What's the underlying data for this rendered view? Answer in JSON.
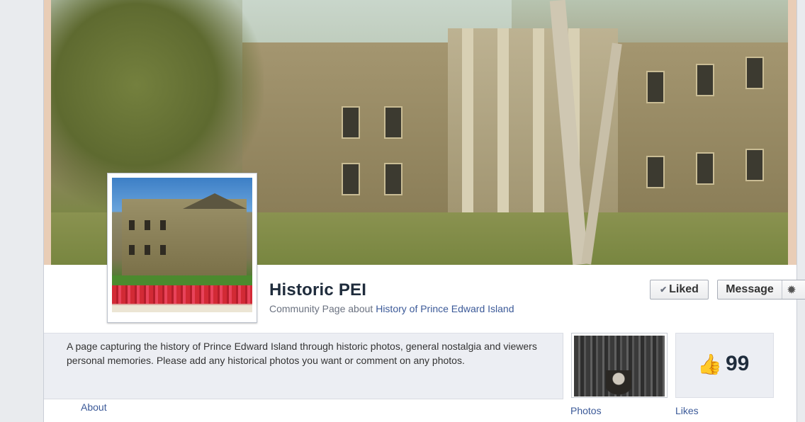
{
  "page": {
    "name": "Historic PEI",
    "subtitle_prefix": "Community Page about ",
    "subtitle_link": "History of Prince Edward Island"
  },
  "actions": {
    "liked_label": "Liked",
    "message_label": "Message",
    "gear_icon": "gear-icon",
    "caret_icon": "chevron-down-icon"
  },
  "about": {
    "description": "A page capturing the history of Prince Edward Island through historic photos, general nostalgia and viewers personal memories. Please add any historical photos you want or comment on any photos.",
    "tab_label": "About"
  },
  "photos": {
    "label": "Photos"
  },
  "likes": {
    "label": "Likes",
    "count": "99"
  },
  "colors": {
    "link": "#3b5998",
    "name": "#1f2c3c",
    "panel": "#eceef3"
  }
}
